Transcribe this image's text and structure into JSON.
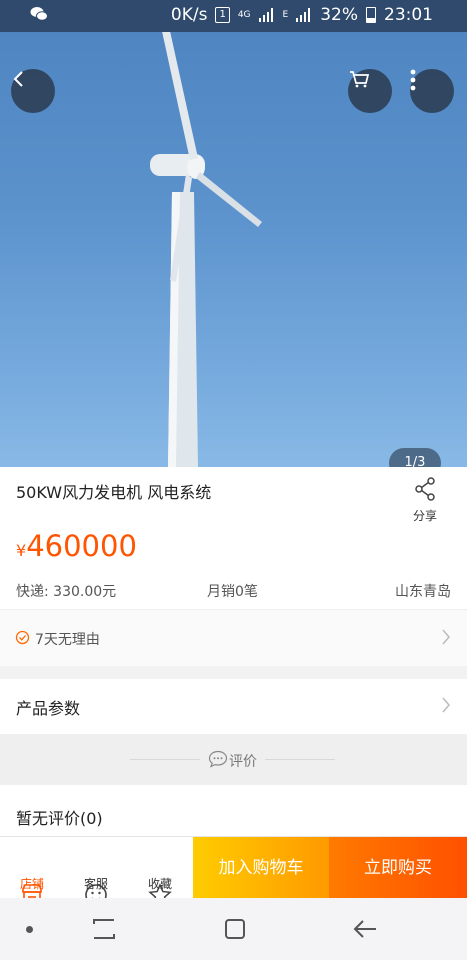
{
  "status_bar": {
    "net_speed": "0K/s",
    "sim": "1",
    "network_type": "4G",
    "network_sub": "E",
    "battery_percent": "32%",
    "time": "23:01",
    "left_icon": "wechat-icon"
  },
  "hero": {
    "page_indicator": "1/3",
    "back_icon": "back-arrow-icon",
    "cart_icon": "cart-icon",
    "more_icon": "more-vertical-icon"
  },
  "product": {
    "title": "50KW风力发电机  风电系统",
    "share_label": "分享",
    "price_symbol": "¥",
    "price": "460000",
    "shipping": "快递: 330.00元",
    "monthly_sales": "月销0笔",
    "location": "山东青岛"
  },
  "service": {
    "return_policy": "7天无理由"
  },
  "params": {
    "label": "产品参数"
  },
  "reviews": {
    "section_label": "评价",
    "empty_text": "暂无评价(0)"
  },
  "action_bar": {
    "store_label": "店铺",
    "service_label": "客服",
    "favorite_label": "收藏",
    "add_to_cart_label": "加入购物车",
    "buy_now_label": "立即购买"
  },
  "colors": {
    "accent": "#ff5500",
    "cart_button": "#ffb300",
    "buy_button": "#ff5f00",
    "status_bar": "#2f4a6d"
  }
}
